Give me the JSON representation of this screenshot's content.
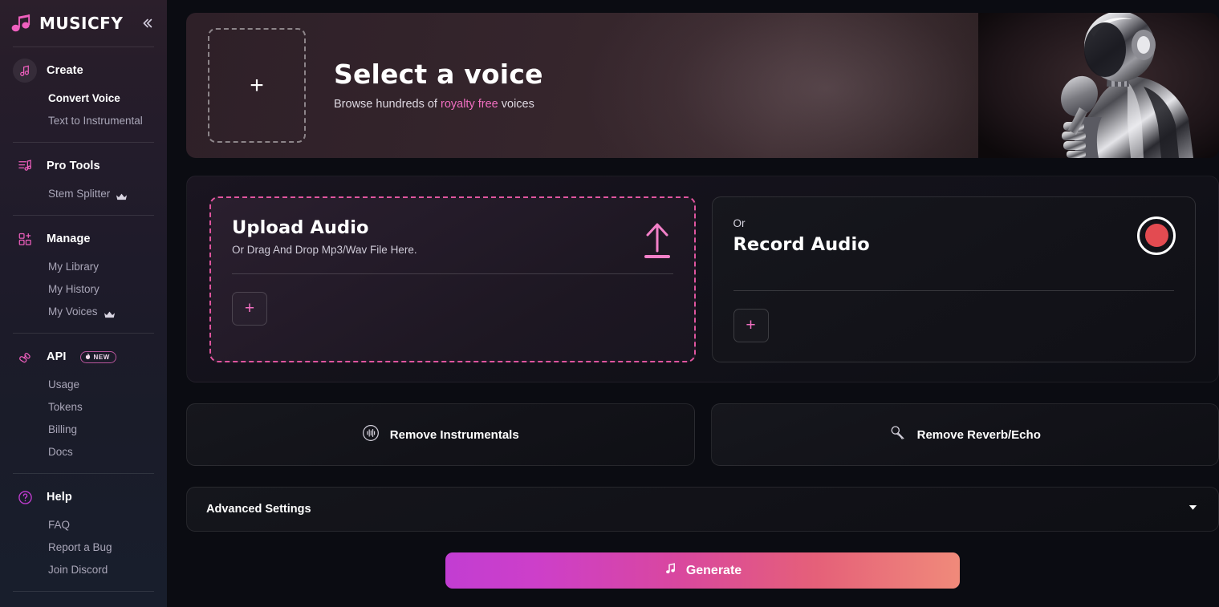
{
  "brand": {
    "name": "MUSICFY",
    "logo_icon": "music-note-icon",
    "collapse_icon": "chevron-double-left-icon"
  },
  "sidebar": {
    "groups": [
      {
        "title": "Create",
        "icon": "music-note-icon",
        "items": [
          {
            "label": "Convert Voice",
            "active": true,
            "pro": false
          },
          {
            "label": "Text to Instrumental",
            "active": false,
            "pro": false
          }
        ]
      },
      {
        "title": "Pro Tools",
        "icon": "equalizer-note-icon",
        "items": [
          {
            "label": "Stem Splitter",
            "active": false,
            "pro": true
          }
        ]
      },
      {
        "title": "Manage",
        "icon": "grid-plus-icon",
        "items": [
          {
            "label": "My Library",
            "active": false,
            "pro": false
          },
          {
            "label": "My History",
            "active": false,
            "pro": false
          },
          {
            "label": "My Voices",
            "active": false,
            "pro": true
          }
        ]
      },
      {
        "title": "API",
        "icon": "plug-connector-icon",
        "badge": "NEW",
        "badge_icon": "flame-icon",
        "items": [
          {
            "label": "Usage",
            "active": false,
            "pro": false
          },
          {
            "label": "Tokens",
            "active": false,
            "pro": false
          },
          {
            "label": "Billing",
            "active": false,
            "pro": false
          },
          {
            "label": "Docs",
            "active": false,
            "pro": false
          }
        ]
      },
      {
        "title": "Help",
        "icon": "question-circle-icon",
        "items": [
          {
            "label": "FAQ",
            "active": false,
            "pro": false
          },
          {
            "label": "Report a Bug",
            "active": false,
            "pro": false
          },
          {
            "label": "Join Discord",
            "active": false,
            "pro": false
          }
        ]
      }
    ]
  },
  "hero": {
    "plus_icon": "plus-icon",
    "title": "Select a voice",
    "subtitle_before": "Browse hundreds of ",
    "subtitle_accent": "royalty free",
    "subtitle_after": " voices",
    "artwork": "robot-singer-with-microphone"
  },
  "upload_card": {
    "title": "Upload Audio",
    "subtitle": "Or Drag And Drop Mp3/Wav File Here.",
    "upload_icon": "upload-arrow-icon",
    "add_icon": "plus-icon"
  },
  "record_card": {
    "or_label": "Or",
    "title": "Record Audio",
    "record_icon": "record-circle-icon",
    "add_icon": "plus-icon"
  },
  "tools": [
    {
      "label": "Remove Instrumentals",
      "icon": "waveform-circle-icon"
    },
    {
      "label": "Remove Reverb/Echo",
      "icon": "microphone-icon"
    }
  ],
  "advanced": {
    "label": "Advanced Settings",
    "chevron_icon": "chevron-down-icon"
  },
  "generate": {
    "label": "Generate",
    "icon": "music-note-icon"
  },
  "colors": {
    "accent_pink": "#f06ec0",
    "accent_magenta": "#e0559f",
    "record_red": "#e34b51",
    "gradient_start": "#c23dd2",
    "gradient_end": "#f08a7a",
    "page_bg": "#0b0c12"
  }
}
